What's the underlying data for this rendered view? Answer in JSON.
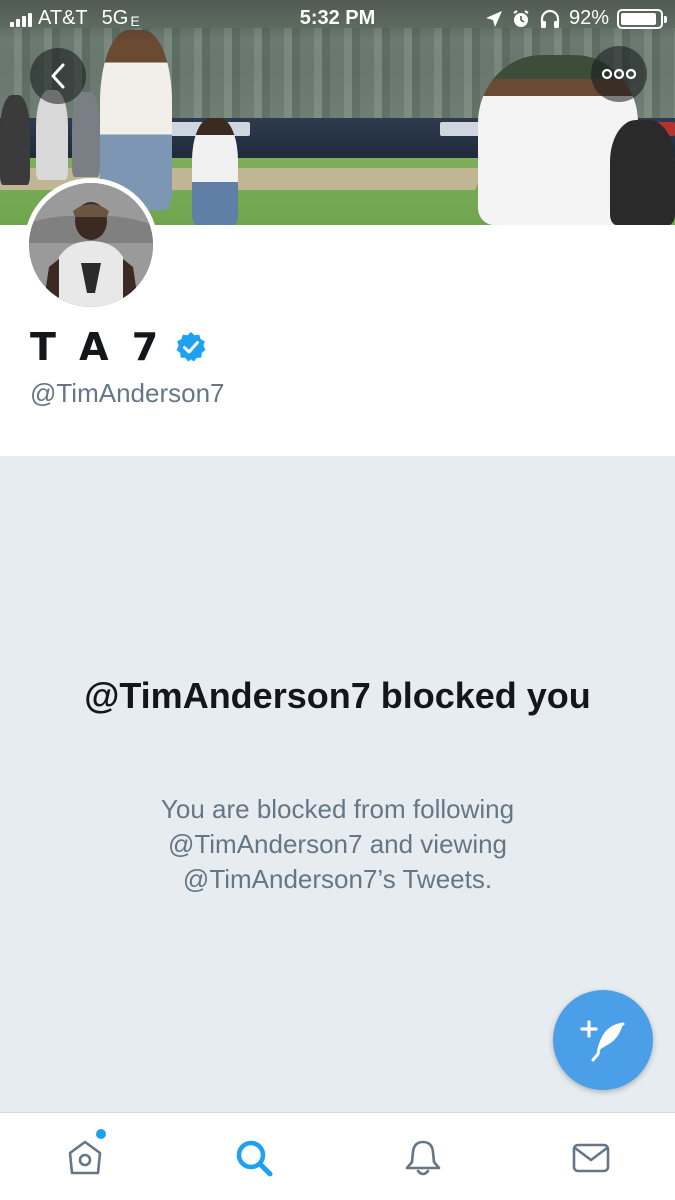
{
  "status_bar": {
    "carrier": "AT&T",
    "network": "5G",
    "network_suffix": "E",
    "time": "5:32 PM",
    "battery_percent": "92%",
    "battery_level": 0.92
  },
  "profile": {
    "display_name": "T A 7",
    "verified": true,
    "handle": "@TimAnderson7"
  },
  "blocked": {
    "title": "@TimAnderson7 blocked you",
    "description": "You are blocked from following @TimAnderson7 and viewing @TimAnderson7’s Tweets."
  },
  "icons": {
    "back": "chevron-left-icon",
    "more": "more-icon",
    "verified": "verified-badge-icon",
    "compose": "compose-tweet-icon",
    "home": "home-icon",
    "search": "search-icon",
    "notifications": "bell-icon",
    "messages": "mail-icon"
  },
  "tabs": [
    {
      "id": "home",
      "has_unread_dot": true,
      "active": false
    },
    {
      "id": "search",
      "has_unread_dot": false,
      "active": true
    },
    {
      "id": "notifications",
      "has_unread_dot": false,
      "active": false
    },
    {
      "id": "messages",
      "has_unread_dot": false,
      "active": false
    }
  ],
  "colors": {
    "accent": "#1da1f2",
    "fab": "#4a9fe8",
    "blocked_bg": "#e6ecf0",
    "secondary_text": "#657786",
    "primary_text": "#14171a",
    "tab_icon": "#657786"
  }
}
